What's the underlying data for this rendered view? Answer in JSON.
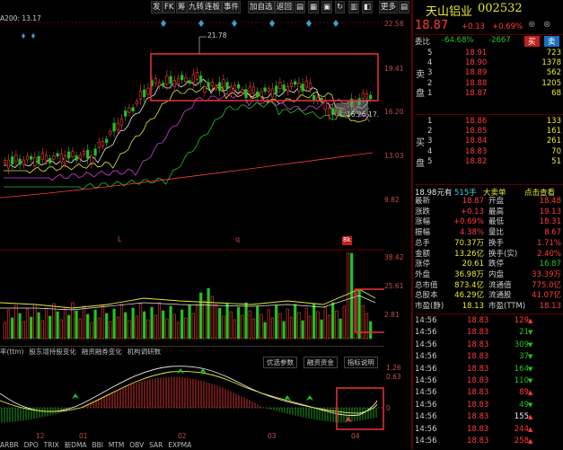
{
  "toolbar": {
    "buttons": [
      "发",
      "FK",
      "筹",
      "九转",
      "连板",
      "事件",
      "加自选",
      "返回"
    ],
    "icon_buttons": [
      "F10",
      "财务",
      "资讯",
      "刷新",
      "工具",
      "预测"
    ],
    "more_label": "更多"
  },
  "chart_top_label": "A200: 13.17",
  "price_axis": [
    "22.58",
    "19.41",
    "16.20",
    "13.03",
    "9.82"
  ],
  "price_annotations": {
    "high": "21.78",
    "range": "16.26-17."
  },
  "candle_markers": [
    "L",
    "q",
    "8k"
  ],
  "volume_axis": [
    "38.42",
    "25.61",
    "2.81"
  ],
  "macd_axis": [
    "1.26",
    "0.63",
    "0"
  ],
  "indicator_tabs_mid": [
    "率(ttm)",
    "股东增持股变化",
    "融资融券变化",
    "机构调研数"
  ],
  "indicator_buttons": [
    "优选参数",
    "融资资金",
    "指标说明"
  ],
  "date_labels": [
    "12",
    "01",
    "02",
    "03",
    "04"
  ],
  "bottom_tabs": [
    "ARBR",
    "DPO",
    "TRIX",
    "新DMA",
    "BBI",
    "MTM",
    "OBV",
    "SAR",
    "EXPMA"
  ],
  "stock": {
    "name": "天山铝业",
    "code": "002532",
    "price": "18.87",
    "change": "+0.13",
    "change_pct": "+0.69%",
    "weibi_label": "委比",
    "weibi": "-64.68%",
    "weicha": "-2667",
    "buy_label": "买",
    "sell_label": "卖"
  },
  "side_labels": {
    "sell": [
      "卖",
      "盘"
    ],
    "buy": [
      "买",
      "盘"
    ]
  },
  "asks": [
    {
      "level": "5",
      "price": "18.91",
      "vol": "723"
    },
    {
      "level": "4",
      "price": "18.90",
      "vol": "1378"
    },
    {
      "level": "3",
      "price": "18.89",
      "vol": "562"
    },
    {
      "level": "2",
      "price": "18.88",
      "vol": "1205"
    },
    {
      "level": "1",
      "price": "18.87",
      "vol": "68"
    }
  ],
  "bids": [
    {
      "level": "1",
      "price": "18.86",
      "vol": "133"
    },
    {
      "level": "2",
      "price": "18.85",
      "vol": "161"
    },
    {
      "level": "3",
      "price": "18.84",
      "vol": "261"
    },
    {
      "level": "4",
      "price": "18.83",
      "vol": "70"
    },
    {
      "level": "5",
      "price": "18.82",
      "vol": "51"
    }
  ],
  "big_order": {
    "price": "18.98元有",
    "vol": "515手",
    "label": "大卖单",
    "link": "点击查看"
  },
  "quote_rows": [
    [
      "最新",
      "18.87",
      "开盘",
      "18.48"
    ],
    [
      "涨跌",
      "+0.13",
      "最高",
      "19.13"
    ],
    [
      "涨幅",
      "+0.69%",
      "最低",
      "18.31"
    ],
    [
      "振幅",
      "4.38%",
      "量比",
      "8.67"
    ],
    [
      "总手",
      "70.37万",
      "换手",
      "1.71%"
    ],
    [
      "金额",
      "13.26亿",
      "换手(实)",
      "2.40%"
    ],
    [
      "涨停",
      "20.61",
      "跌停",
      "16.87"
    ],
    [
      "外盘",
      "36.98万",
      "内盘",
      "33.39万"
    ],
    [
      "总市值",
      "873.4亿",
      "流通值",
      "775.0亿"
    ],
    [
      "总股本",
      "46.29亿",
      "流通股",
      "41.07亿"
    ],
    [
      "市盈(静)",
      "18.13",
      "市盈(TTM)",
      "18.13"
    ]
  ],
  "ticks": [
    {
      "time": "14:56",
      "price": "18.83",
      "vol": "129"
    },
    {
      "time": "14:56",
      "price": "18.83",
      "vol": "21"
    },
    {
      "time": "14:56",
      "price": "18.83",
      "vol": "309"
    },
    {
      "time": "14:56",
      "price": "18.83",
      "vol": "37"
    },
    {
      "time": "14:56",
      "price": "18.83",
      "vol": "164"
    },
    {
      "time": "14:56",
      "price": "18.83",
      "vol": "110"
    },
    {
      "time": "14:56",
      "price": "18.83",
      "vol": "89"
    },
    {
      "time": "14:56",
      "price": "18.83",
      "vol": "49"
    },
    {
      "time": "14:56",
      "price": "18.83",
      "vol": "155"
    },
    {
      "time": "14:56",
      "price": "18.83",
      "vol": "244"
    },
    {
      "time": "14:56",
      "price": "18.83",
      "vol": "258"
    }
  ],
  "colors": {
    "up": "#ff3b3b",
    "down": "#23c223",
    "highlight": "#e03030",
    "background": "#000000"
  }
}
